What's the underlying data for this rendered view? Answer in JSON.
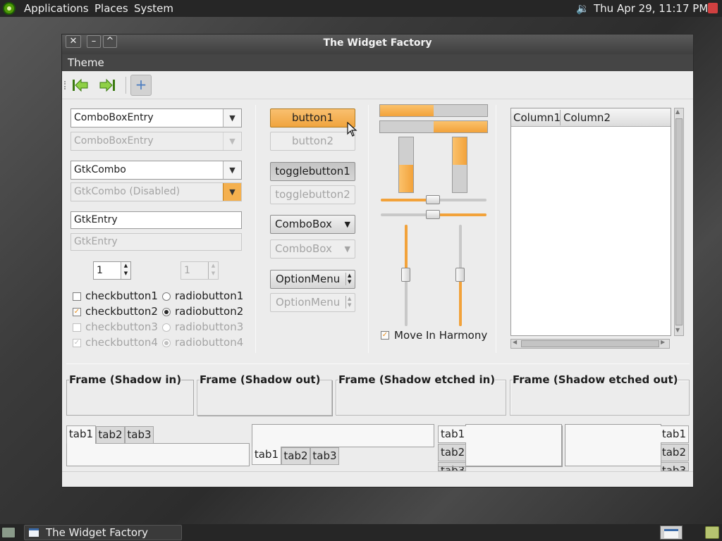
{
  "top_panel": {
    "menus": [
      "Applications",
      "Places",
      "System"
    ],
    "volume_icon": "speaker-icon",
    "clock": "Thu Apr 29, 11:17 PM"
  },
  "window": {
    "title": "The Widget Factory",
    "buttons": {
      "close": "✕",
      "minimize": "–",
      "maximize": "^"
    },
    "menu": {
      "theme": "Theme"
    },
    "toolbar": {
      "back_icon": "go-first-icon",
      "forward_icon": "go-last-icon",
      "add": "+"
    }
  },
  "left": {
    "combo_entry": "ComboBoxEntry",
    "combo_entry_disabled": "ComboBoxEntry",
    "gtk_combo": "GtkCombo",
    "gtk_combo_disabled": "GtkCombo (Disabled)",
    "entry": "GtkEntry",
    "entry_disabled": "GtkEntry",
    "spin": "1",
    "spin_disabled": "1",
    "checks": [
      {
        "label": "checkbutton1",
        "checked": false,
        "disabled": false
      },
      {
        "label": "checkbutton2",
        "checked": true,
        "disabled": false
      },
      {
        "label": "checkbutton3",
        "checked": false,
        "disabled": true
      },
      {
        "label": "checkbutton4",
        "checked": true,
        "disabled": true
      }
    ],
    "radios": [
      {
        "label": "radiobutton1",
        "selected": false,
        "disabled": false
      },
      {
        "label": "radiobutton2",
        "selected": true,
        "disabled": false
      },
      {
        "label": "radiobutton3",
        "selected": false,
        "disabled": true
      },
      {
        "label": "radiobutton4",
        "selected": true,
        "disabled": true
      }
    ]
  },
  "middle": {
    "button1": "button1",
    "button2": "button2",
    "toggle1": "togglebutton1",
    "toggle2": "togglebutton2",
    "combobox": "ComboBox",
    "combobox_disabled": "ComboBox",
    "optionmenu": "OptionMenu",
    "optionmenu_disabled": "OptionMenu"
  },
  "ranges": {
    "hprogress1": 0.5,
    "hprogress2": 0.5,
    "vprogress1": 0.5,
    "vprogress2": 0.5,
    "hscale1": 0.5,
    "hscale2": 0.5,
    "vscale1": 0.5,
    "vscale2": 0.5,
    "move_in_harmony": "Move In Harmony",
    "move_in_harmony_checked": true
  },
  "tree": {
    "columns": [
      "Column1",
      "Column2"
    ]
  },
  "frames": [
    "Frame (Shadow in)",
    "Frame (Shadow out)",
    "Frame (Shadow etched in)",
    "Frame (Shadow etched out)"
  ],
  "notebooks": {
    "tabs": [
      "tab1",
      "tab2",
      "tab3"
    ]
  },
  "taskbar": {
    "task": "The Widget Factory"
  },
  "colors": {
    "accent": "#f2a23a",
    "panel": "#262626"
  }
}
